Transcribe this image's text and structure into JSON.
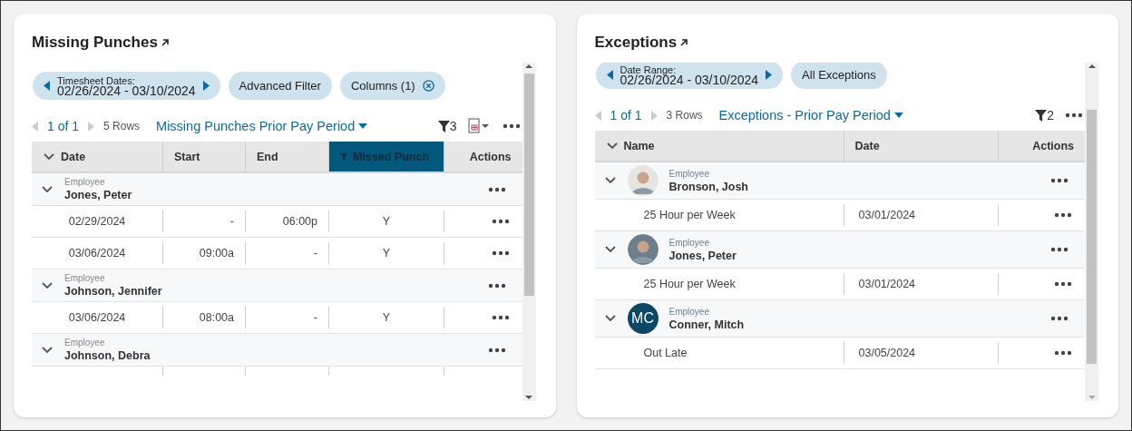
{
  "missing_punches": {
    "title": "Missing Punches",
    "chips": [
      {
        "kind": "stepper",
        "label": "Timesheet Dates:",
        "value": "02/26/2024 - 03/10/2024"
      },
      {
        "kind": "plain",
        "label": "Advanced Filter"
      },
      {
        "kind": "removable",
        "label": "Columns (1)"
      }
    ],
    "pager": {
      "page": "1 of 1",
      "rows": "5 Rows"
    },
    "view": "Missing Punches Prior Pay Period",
    "filter_count": "3",
    "columns": [
      {
        "label": "Date",
        "filtered": false
      },
      {
        "label": "Start",
        "filtered": false
      },
      {
        "label": "End",
        "filtered": false
      },
      {
        "label": "Missed Punch",
        "filtered": true
      },
      {
        "label": "Actions",
        "filtered": false
      }
    ],
    "groups": [
      {
        "caption": "Employee",
        "name": "Jones, Peter",
        "expanded": true,
        "rows": [
          {
            "date": "02/29/2024",
            "start": "-",
            "end": "06:00p",
            "missed": "Y"
          },
          {
            "date": "03/06/2024",
            "start": "09:00a",
            "end": "-",
            "missed": "Y"
          }
        ]
      },
      {
        "caption": "Employee",
        "name": "Johnson, Jennifer",
        "expanded": true,
        "rows": [
          {
            "date": "03/06/2024",
            "start": "08:00a",
            "end": "-",
            "missed": "Y"
          }
        ]
      },
      {
        "caption": "Employee",
        "name": "Johnson, Debra",
        "expanded": true
      }
    ]
  },
  "exceptions": {
    "title": "Exceptions",
    "chips": [
      {
        "kind": "stepper",
        "label": "Date Range:",
        "value": "02/26/2024 - 03/10/2024"
      },
      {
        "kind": "plain",
        "label": "All Exceptions"
      }
    ],
    "pager": {
      "page": "1 of 1",
      "rows": "3 Rows"
    },
    "view": "Exceptions - Prior Pay Period",
    "filter_count": "2",
    "columns": [
      {
        "label": "Name"
      },
      {
        "label": "Date"
      },
      {
        "label": "Actions"
      }
    ],
    "groups": [
      {
        "caption": "Employee",
        "name": "Bronson, Josh",
        "expanded": true,
        "avatar": {
          "kind": "photo",
          "color": "#e6e4e0"
        },
        "rows": [
          {
            "name": "25 Hour per Week",
            "date": "03/01/2024"
          }
        ]
      },
      {
        "caption": "Employee",
        "name": "Jones, Peter",
        "expanded": true,
        "avatar": {
          "kind": "photo",
          "color": "#6d7f8c"
        },
        "rows": [
          {
            "name": "25 Hour per Week",
            "date": "03/01/2024"
          }
        ]
      },
      {
        "caption": "Employee",
        "name": "Conner, Mitch",
        "expanded": true,
        "avatar": {
          "kind": "initials",
          "text": "MC",
          "color": "#0c4766"
        },
        "rows": [
          {
            "name": "Out Late",
            "date": "03/05/2024"
          }
        ]
      }
    ]
  }
}
